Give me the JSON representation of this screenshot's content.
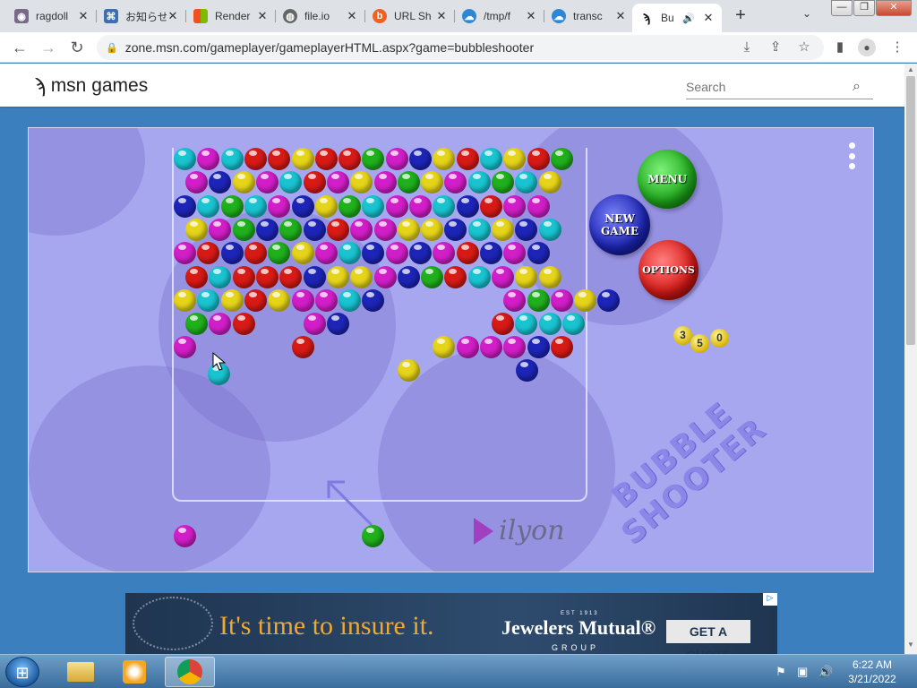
{
  "browser": {
    "tabs": [
      {
        "title": "ragdoll",
        "icon": "ragdoll-favicon"
      },
      {
        "title": "お知らせ",
        "icon": "notice-favicon"
      },
      {
        "title": "Render",
        "icon": "microsoft-favicon"
      },
      {
        "title": "file.io",
        "icon": "globe-favicon"
      },
      {
        "title": "URL Sh",
        "icon": "bitly-favicon"
      },
      {
        "title": "/tmp/f",
        "icon": "cloud-favicon"
      },
      {
        "title": "transc",
        "icon": "cloud-favicon"
      },
      {
        "title": "Bu",
        "icon": "msn-butterfly-favicon",
        "active": true,
        "audio": "speaker-icon"
      }
    ],
    "new_tab": "+",
    "tab_menu": "⌄",
    "window_buttons": [
      "—",
      "❐",
      "✕"
    ],
    "url": "zone.msn.com/gameplayer/gameplayerHTML.aspx?game=bubbleshooter",
    "nav": {
      "back": "←",
      "forward": "→",
      "reload": "↻"
    },
    "toolbar_icons": [
      "install-icon",
      "share-icon",
      "bookmark-star-icon",
      "side-panel-icon",
      "profile-icon",
      "kebab-menu-icon"
    ]
  },
  "msn": {
    "logo_text": "msn games",
    "search_placeholder": "Search"
  },
  "game": {
    "title_logo": "BUBBLE\nSHOOTER",
    "score": [
      "3",
      "5",
      "0"
    ],
    "buttons": {
      "menu": "MENU",
      "new_game": "NEW\nGAME",
      "options": "OPTIONS"
    },
    "publisher": "ilyon",
    "colors": {
      "c": "#19c3d0",
      "m": "#d21ec8",
      "r": "#d81a16",
      "y": "#e6d41a",
      "g": "#1fb01c",
      "b": "#1d25b8"
    },
    "grid": [
      "cmcrryrrgmbyrcyrg",
      "mbymcrmymgymcgcy",
      "bcgcmbygcmmcbrmm",
      "ymgbgbrmmyybcybc",
      "mrbrgymcbmbmrbmb",
      "rcrrrbyymbgrcmyy",
      "ycyrymmcb.....mgmyb",
      "gmr..mb......rccc",
      "m....r.....ymmmbr"
    ],
    "current_ball": "green",
    "next_ball": "magenta"
  },
  "ad": {
    "headline": "It's time to insure it.",
    "brand": "Jewelers Mutual®",
    "est": "EST 1913",
    "group": "GROUP",
    "cta": "GET A QUOTE"
  },
  "taskbar": {
    "time": "6:22 AM",
    "date": "3/21/2022",
    "apps": [
      "explorer-icon",
      "media-player-icon",
      "chrome-icon"
    ]
  }
}
